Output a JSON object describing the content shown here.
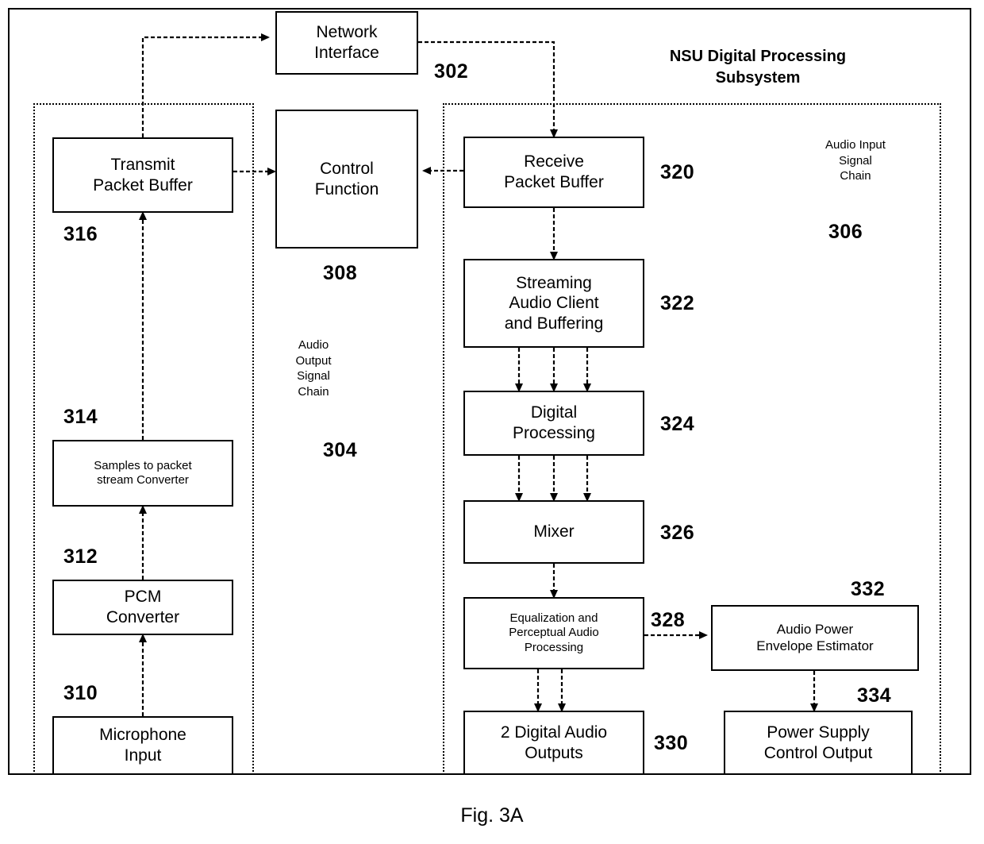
{
  "figure": {
    "caption": "Fig. 3A",
    "title": "NSU Digital Processing\nSubsystem"
  },
  "chain_labels": {
    "audio_output": "Audio\nOutput\nSignal\nChain",
    "audio_output_ref": "304",
    "audio_input": "Audio Input\nSignal\nChain",
    "audio_input_ref": "306"
  },
  "nodes": {
    "network_interface": {
      "label": "Network\nInterface",
      "ref": "302"
    },
    "control_function": {
      "label": "Control\nFunction",
      "ref": "308"
    },
    "transmit_packet_buffer": {
      "label": "Transmit\nPacket Buffer",
      "ref": "316"
    },
    "samples_to_packet": {
      "label": "Samples to packet\nstream Converter",
      "ref": "314"
    },
    "pcm_converter": {
      "label": "PCM\nConverter",
      "ref": "312"
    },
    "microphone_input": {
      "label": "Microphone\nInput",
      "ref": "310"
    },
    "receive_packet_buffer": {
      "label": "Receive\nPacket Buffer",
      "ref": "320"
    },
    "streaming_audio_client": {
      "label": "Streaming\nAudio Client\nand Buffering",
      "ref": "322"
    },
    "digital_processing": {
      "label": "Digital\nProcessing",
      "ref": "324"
    },
    "mixer": {
      "label": "Mixer",
      "ref": "326"
    },
    "equalization": {
      "label": "Equalization and\nPerceptual Audio\nProcessing",
      "ref": "328"
    },
    "digital_audio_outputs": {
      "label": "2 Digital Audio\nOutputs",
      "ref": "330"
    },
    "audio_power_envelope": {
      "label": "Audio Power\nEnvelope Estimator",
      "ref": "332"
    },
    "power_supply_control": {
      "label": "Power Supply\nControl Output",
      "ref": "334"
    }
  },
  "colors": {
    "stroke": "#000000",
    "background": "#ffffff"
  }
}
